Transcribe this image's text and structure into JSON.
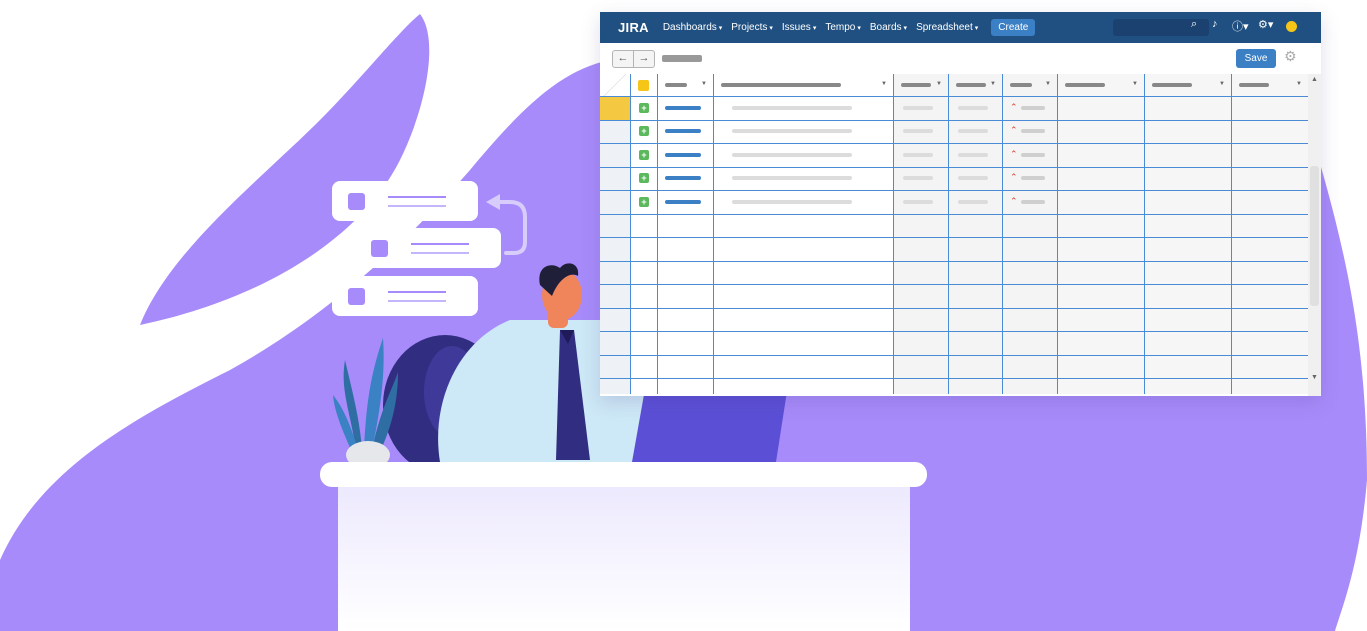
{
  "header": {
    "logo": "JIRA",
    "nav": [
      {
        "label": "Dashboards",
        "caret": "▾"
      },
      {
        "label": "Projects",
        "caret": "▾"
      },
      {
        "label": "Issues",
        "caret": "▾"
      },
      {
        "label": "Tempo",
        "caret": "▾"
      },
      {
        "label": "Boards",
        "caret": "▾"
      },
      {
        "label": "Spreadsheet",
        "caret": "▾"
      }
    ],
    "create_label": "Create",
    "icons": [
      "search-icon",
      "notifications-icon",
      "help-icon",
      "settings-icon",
      "avatar-icon"
    ]
  },
  "toolbar": {
    "back_icon": "←",
    "forward_icon": "→",
    "save_label": "Save",
    "gear_icon": "⚙"
  },
  "grid": {
    "filled_rows": 5,
    "empty_rows": 7,
    "priority_icon": "highest-priority-icon"
  },
  "colors": {
    "brand": "#205081",
    "accent": "#3b7fc4",
    "purple": "#a78bfa",
    "grid_line": "#4a8bd6",
    "add_green": "#5cb85c"
  }
}
